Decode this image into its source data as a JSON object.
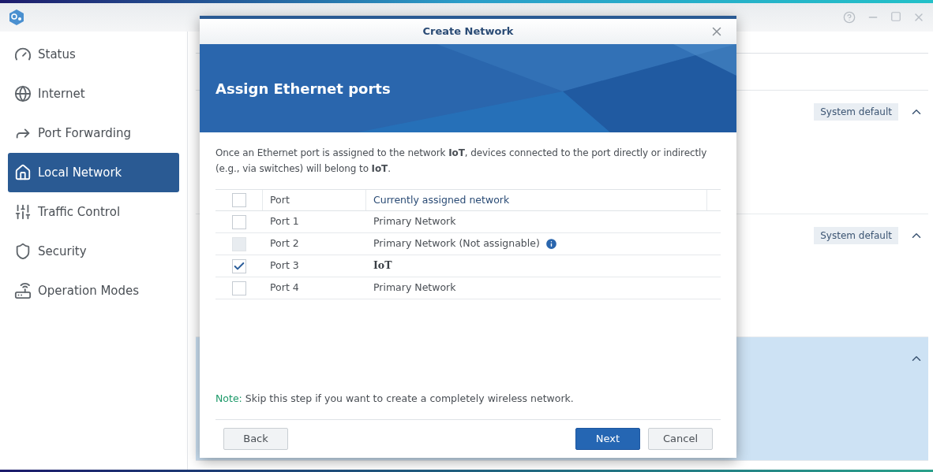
{
  "sidebar": {
    "items": [
      {
        "label": "Status",
        "kind": "gauge",
        "selected": false
      },
      {
        "label": "Internet",
        "kind": "globe",
        "selected": false
      },
      {
        "label": "Port Forwarding",
        "kind": "forward",
        "selected": false
      },
      {
        "label": "Local Network",
        "kind": "home",
        "selected": true
      },
      {
        "label": "Traffic Control",
        "kind": "sliders",
        "selected": false
      },
      {
        "label": "Security",
        "kind": "shield",
        "selected": false
      },
      {
        "label": "Operation Modes",
        "kind": "router",
        "selected": false
      }
    ]
  },
  "panels": [
    {
      "badge": "System default",
      "expanded": true,
      "selected": false
    },
    {
      "badge": "System default",
      "expanded": true,
      "selected": false
    },
    {
      "expanded": true,
      "selected": true
    }
  ],
  "dialog": {
    "title": "Create Network",
    "heading": "Assign Ethernet ports",
    "description": "Once an Ethernet port is assigned to the network **IoT**, devices connected to the port directly or indirectly (e.g., via switches) will belong to **IoT**.",
    "table": {
      "header_checked": false,
      "columns": [
        "Port",
        "Currently assigned network"
      ],
      "rows": [
        {
          "port": "Port 1",
          "network": "Primary Network",
          "checked": false,
          "disabled": false,
          "emphasis": false,
          "info": false
        },
        {
          "port": "Port 2",
          "network": "Primary Network (Not assignable)",
          "checked": false,
          "disabled": true,
          "emphasis": false,
          "info": true
        },
        {
          "port": "Port 3",
          "network": "IoT",
          "checked": true,
          "disabled": false,
          "emphasis": true,
          "info": false
        },
        {
          "port": "Port 4",
          "network": "Primary Network",
          "checked": false,
          "disabled": false,
          "emphasis": false,
          "info": false
        }
      ]
    },
    "note_label": "Note:",
    "note": "Skip this step if you want to create a completely wireless network.",
    "buttons": [
      {
        "label": "Back",
        "kind": "secondary"
      },
      {
        "label": "Next",
        "kind": "primary"
      },
      {
        "label": "Cancel",
        "kind": "secondary"
      }
    ]
  }
}
